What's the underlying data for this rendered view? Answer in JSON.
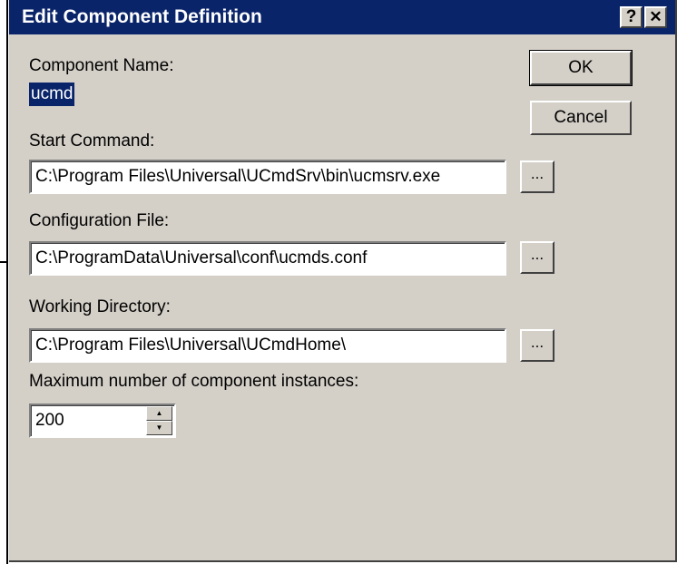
{
  "window": {
    "title": "Edit Component Definition",
    "help_glyph": "?",
    "close_glyph": "✕"
  },
  "component_name": {
    "label": "Component Name:",
    "value": "ucmd"
  },
  "buttons": {
    "ok": "OK",
    "cancel": "Cancel",
    "browse": "..."
  },
  "start_command": {
    "label": "Start Command:",
    "value": "C:\\Program Files\\Universal\\UCmdSrv\\bin\\ucmsrv.exe"
  },
  "configuration_file": {
    "label": "Configuration File:",
    "value": "C:\\ProgramData\\Universal\\conf\\ucmds.conf"
  },
  "working_directory": {
    "label": "Working Directory:",
    "value": "C:\\Program Files\\Universal\\UCmdHome\\"
  },
  "max_instances": {
    "label": "Maximum number of component instances:",
    "value": "200",
    "up_glyph": "▲",
    "down_glyph": "▼"
  },
  "colors": {
    "titlebar": "#0a246a",
    "dialog_face": "#d4d0c8",
    "selection": "#0a246a"
  },
  "icons": [
    "help-icon",
    "close-icon",
    "spin-up-icon",
    "spin-down-icon"
  ]
}
